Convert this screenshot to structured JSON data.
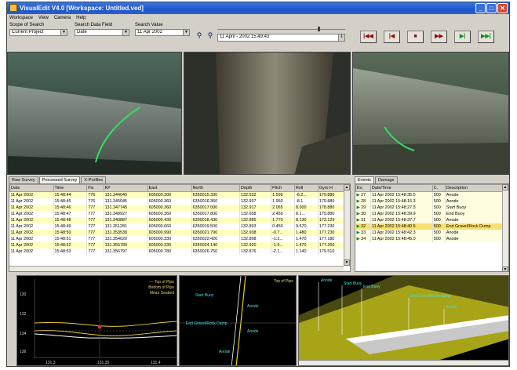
{
  "window": {
    "title": "VisualEdit V4.0 [Workspace: Untitled.ved]",
    "colors": {
      "titlebar": "#1d55c8",
      "face": "#d4d0c8",
      "selected_row": "#ffffc0",
      "event_selected": "#f8e070",
      "plot_bg": "#000000",
      "trace_yellow": "#e8d020",
      "trace_white": "#ffffff"
    }
  },
  "menu": [
    "Workspace",
    "View",
    "Camera",
    "Help"
  ],
  "search": {
    "scope_label": "Scope of Search",
    "scope_value": "Current Project",
    "field_label": "Search Data Field",
    "field_value": "Date",
    "value_label": "Search Value",
    "value_value": "11 Apr 2002",
    "datetime_value": "11    April  -  2002  15:49:43",
    "icons": [
      "binoculars-icon",
      "binoculars-next-icon"
    ]
  },
  "nav_buttons": [
    "first-record-icon",
    "previous-record-icon",
    "stop-icon",
    "next-fast-icon",
    "play-icon",
    "last-record-icon"
  ],
  "survey_tabs": [
    "Raw Survey",
    "Processed Survey",
    "X-Profiles"
  ],
  "survey": {
    "columns": [
      "Date",
      "Time",
      "Fix",
      "KP",
      "East",
      "North",
      "Depth",
      "Pitch",
      "Roll",
      "Gyro H"
    ],
    "rows": [
      [
        "11 Apr 2002",
        "15:48:44",
        "776",
        "131.344045",
        "605000.300",
        "6350015.330",
        "132.532",
        "1.590",
        "-8.2...",
        "179.880"
      ],
      [
        "11 Apr 2002",
        "15:48:45",
        "776",
        "131.345045",
        "605000.360",
        "6350016.360",
        "132.937",
        "1.950",
        "-8.1",
        "179.880"
      ],
      [
        "11 Apr 2002",
        "15:48:46",
        "777",
        "131.347745",
        "605000.360",
        "6350017.000",
        "132.917",
        "2.065",
        "8.000",
        "178.880"
      ],
      [
        "11 Apr 2002",
        "15:48:47",
        "777",
        "131.348927",
        "605000.360",
        "6350017.800",
        "132.658",
        "2.450",
        "8.1...",
        "179.880"
      ],
      [
        "11 Apr 2002",
        "15:48:48",
        "777",
        "131.349887",
        "605000.430",
        "6350018.430",
        "132.885",
        "1.770",
        "8.130",
        "173.129"
      ],
      [
        "11 Apr 2002",
        "15:48:49",
        "777",
        "131.351281",
        "605000.660",
        "6350019.500",
        "132.893",
        "0.450",
        "9.570",
        "177.230"
      ],
      [
        "11 Apr 2002",
        "15:48:50",
        "777",
        "131.353538",
        "605000.990",
        "6350021.790",
        "132.938",
        "-0.7...",
        "1.480",
        "177.230"
      ],
      [
        "11 Apr 2002",
        "15:48:51",
        "777",
        "131.354020",
        "605000.330",
        "6350022.420",
        "132.898",
        "-1.2...",
        "1.470",
        "177.180"
      ],
      [
        "11 Apr 2002",
        "15:48:52",
        "777",
        "131.355789",
        "605000.330",
        "6350024.140",
        "132.920",
        "-1.9...",
        "1.470",
        "177.260"
      ],
      [
        "11 Apr 2002",
        "15:48:53",
        "777",
        "131.356797",
        "605000.780",
        "6350026.750",
        "132.876",
        "-2.1...",
        "1.140",
        "179.510"
      ]
    ]
  },
  "event_tabs": [
    "Events",
    "Damage"
  ],
  "events": {
    "columns": [
      "Ev.",
      "Date/Time",
      "C.",
      "Description"
    ],
    "rows": [
      [
        "27",
        "11 Apr 2002 15:48:35.5",
        "500",
        "Anode"
      ],
      [
        "28",
        "11 Apr 2002 15:48:15.3",
        "500",
        "Anode"
      ],
      [
        "29",
        "11 Apr 2002 15:48:27.5",
        "500",
        "Start Buoy"
      ],
      [
        "30",
        "11 Apr 2002 15:48:39.9",
        "500",
        "End Buoy"
      ],
      [
        "31",
        "11 Apr 2002 15:48:37.7",
        "500",
        "Anode"
      ],
      [
        "32",
        "11 Apr 2002 15:48:40.5",
        "500",
        "End Gravel/Rock Dump"
      ],
      [
        "33",
        "11 Apr 2002 15:48:42.3",
        "500",
        "Anode"
      ],
      [
        "34",
        "11 Apr 2002 15:48:45.0",
        "500",
        "Anode"
      ]
    ]
  },
  "profile_plot": {
    "legend": [
      "— Top of Pipe",
      "Bottom of Pipe",
      "Mean Seabed"
    ],
    "y_ticks": [
      "130",
      "132",
      "134",
      "136"
    ],
    "x_ticks": [
      "131.3",
      "131.35",
      "131.4"
    ]
  },
  "longitudinal_plot": {
    "top_label": "Top of Pipe",
    "labels": [
      "Start Buoy",
      "Anode",
      "End Gravel/Rock Dump",
      "Anode",
      "Anode"
    ]
  },
  "three_d_plot": {
    "labels": [
      "Anode",
      "Start Buoy",
      "End Buoy",
      "End Gravel/Rock dump",
      "Anode"
    ]
  }
}
